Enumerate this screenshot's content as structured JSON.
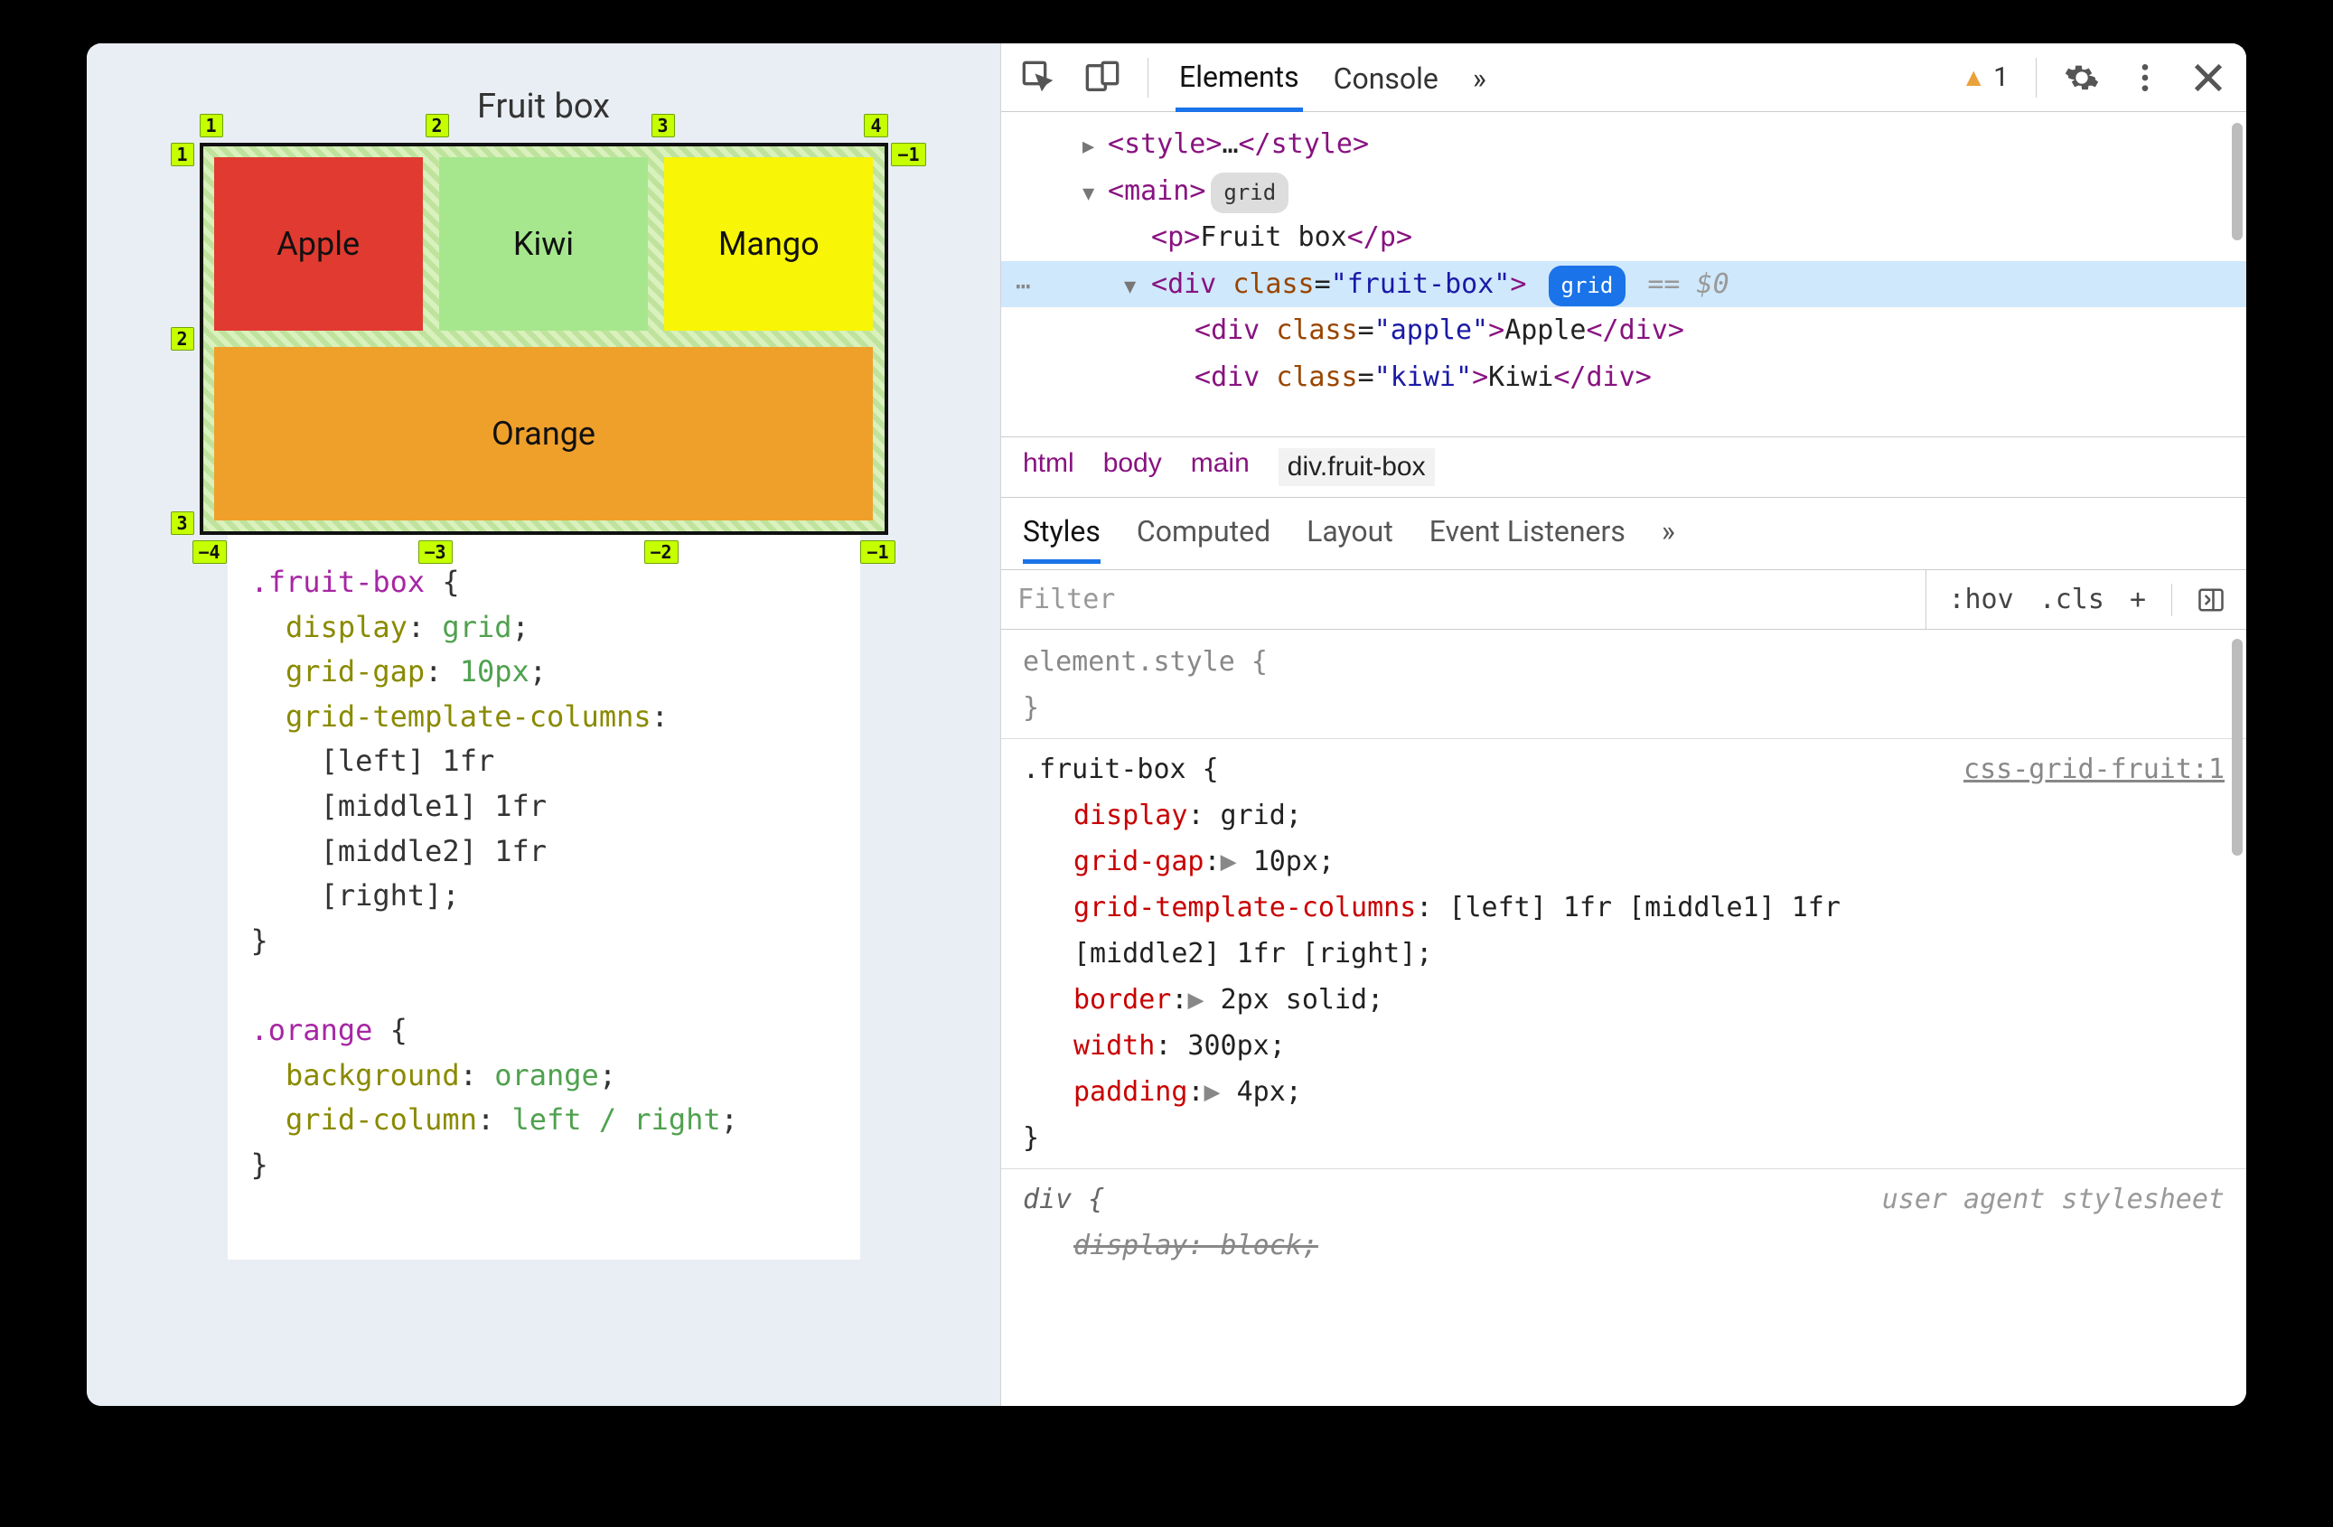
{
  "leftPane": {
    "title": "Fruit box",
    "cells": {
      "apple": "Apple",
      "kiwi": "Kiwi",
      "mango": "Mango",
      "orange": "Orange"
    },
    "gridLabels": {
      "top": [
        "1",
        "2",
        "3",
        "4"
      ],
      "leftSide": [
        "1",
        "2",
        "3"
      ],
      "rightSide": [
        "−1"
      ],
      "bottom": [
        "−4",
        "−3",
        "−2",
        "−1"
      ]
    },
    "code": {
      "sel1": ".fruit-box",
      "brace_open": " {",
      "p1": {
        "k": "display",
        "v": " grid"
      },
      "p2": {
        "k": "grid-gap",
        "v": " 10px"
      },
      "p3": {
        "k": "grid-template-columns",
        "v": ""
      },
      "lineA": "    [left] 1fr",
      "lineB": "    [middle1] 1fr",
      "lineC": "    [middle2] 1fr",
      "lineD": "    [right];",
      "brace_close": "}",
      "sel2": ".orange",
      "p4": {
        "k": "background",
        "v": " orange"
      },
      "p5": {
        "k": "grid-column",
        "v": " left / right"
      }
    }
  },
  "toolbar": {
    "tabs": {
      "elements": "Elements",
      "console": "Console"
    },
    "more": "»",
    "warningCount": "1"
  },
  "dom": {
    "r1": {
      "open": "<",
      "tag": "style",
      "close": ">",
      "ell": "…",
      "open2": "</",
      "close2": ">"
    },
    "r2": {
      "open": "<",
      "tag": "main",
      "close": ">",
      "badge": "grid"
    },
    "r3": {
      "open": "<",
      "tag": "p",
      "close": ">",
      "txt": "Fruit box",
      "open2": "</",
      "close2": ">"
    },
    "r4": {
      "open": "<",
      "tag": "div",
      "sp": " ",
      "attr": "class",
      "eq": "=",
      "val": "\"fruit-box\"",
      "close": ">",
      "badge": "grid",
      "eq0": "== $0"
    },
    "r5": {
      "open": "<",
      "tag": "div",
      "sp": " ",
      "attr": "class",
      "eq": "=",
      "val": "\"apple\"",
      "close": ">",
      "txt": "Apple",
      "open2": "</",
      "close2": ">"
    },
    "r6": {
      "open": "<",
      "tag": "div",
      "sp": " ",
      "attr": "class",
      "eq": "=",
      "val": "\"kiwi\"",
      "close": ">",
      "txt": "Kiwi",
      "open2": "</",
      "close2": ">"
    }
  },
  "breadcrumb": {
    "c1": "html",
    "c2": "body",
    "c3": "main",
    "c4": "div.fruit-box"
  },
  "lowerTabs": {
    "styles": "Styles",
    "computed": "Computed",
    "layout": "Layout",
    "events": "Event Listeners",
    "more": "»"
  },
  "filter": {
    "placeholder": "Filter",
    "hov": ":hov",
    "cls": ".cls",
    "plus": "+"
  },
  "styles": {
    "elStyle": "element.style {",
    "brace": "}",
    "fb": {
      "sel": ".fruit-box {",
      "src": "css-grid-fruit:1",
      "d": {
        "k": "display",
        "v": " grid;"
      },
      "g": {
        "k": "grid-gap",
        "exp": "▶ ",
        "v": "10px;"
      },
      "gtc_k": "grid-template-columns",
      "gtc_v1": " [left] 1fr [middle1] 1fr",
      "gtc_v2": "    [middle2] 1fr [right];",
      "b": {
        "k": "border",
        "exp": "▶ ",
        "v": "2px solid;"
      },
      "w": {
        "k": "width",
        "v": " 300px;"
      },
      "p": {
        "k": "padding",
        "exp": "▶ ",
        "v": "4px;"
      }
    },
    "divRule": {
      "sel": "div {",
      "src": "user agent stylesheet",
      "d": {
        "k": "display",
        "v": "block;"
      }
    }
  }
}
